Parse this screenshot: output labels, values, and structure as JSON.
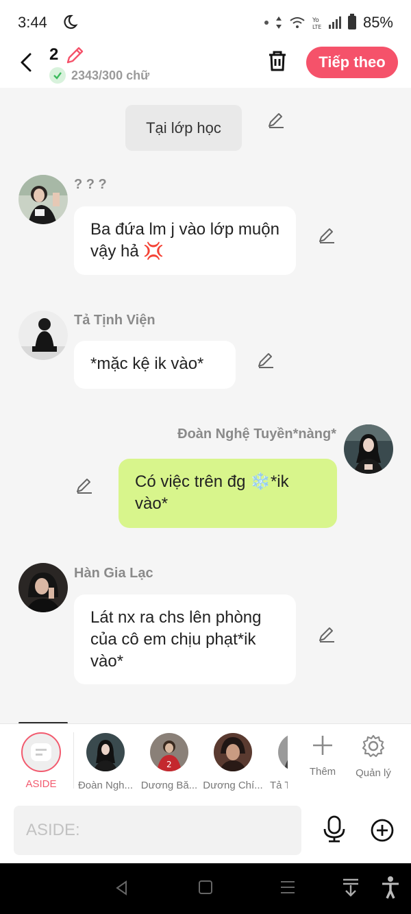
{
  "status_bar": {
    "time": "3:44",
    "battery": "85%"
  },
  "header": {
    "count": "2",
    "word_count": "2343/300 chữ",
    "next_label": "Tiếp theo"
  },
  "messages": [
    {
      "type": "narration",
      "text": "Tại lớp học"
    },
    {
      "type": "left",
      "name": "? ? ?",
      "text": "Ba đứa lm j vào lớp muộn vậy hả 💢"
    },
    {
      "type": "left",
      "name": "Tả Tịnh Viện",
      "text": "*mặc kệ ik vào*"
    },
    {
      "type": "right",
      "name": "Đoàn Nghệ Tuyền*nàng*",
      "text": "Có việc trên đg ❄️*ik vào*"
    },
    {
      "type": "left",
      "name": "Hàn Gia Lạc",
      "text": "Lát nx ra chs lên phòng của cô em chịu phạt*ik vào*"
    }
  ],
  "character_bar": {
    "aside_label": "ASIDE",
    "characters": [
      "Đoàn Ngh...",
      "Dương Bă...",
      "Dương Chí...",
      "Tả T"
    ],
    "add_label": "Thêm",
    "manage_label": "Quản lý"
  },
  "input": {
    "placeholder": "ASIDE:"
  },
  "colors": {
    "accent": "#f5526a",
    "self_bubble": "#d8f58c",
    "background": "#f5f5f5"
  }
}
